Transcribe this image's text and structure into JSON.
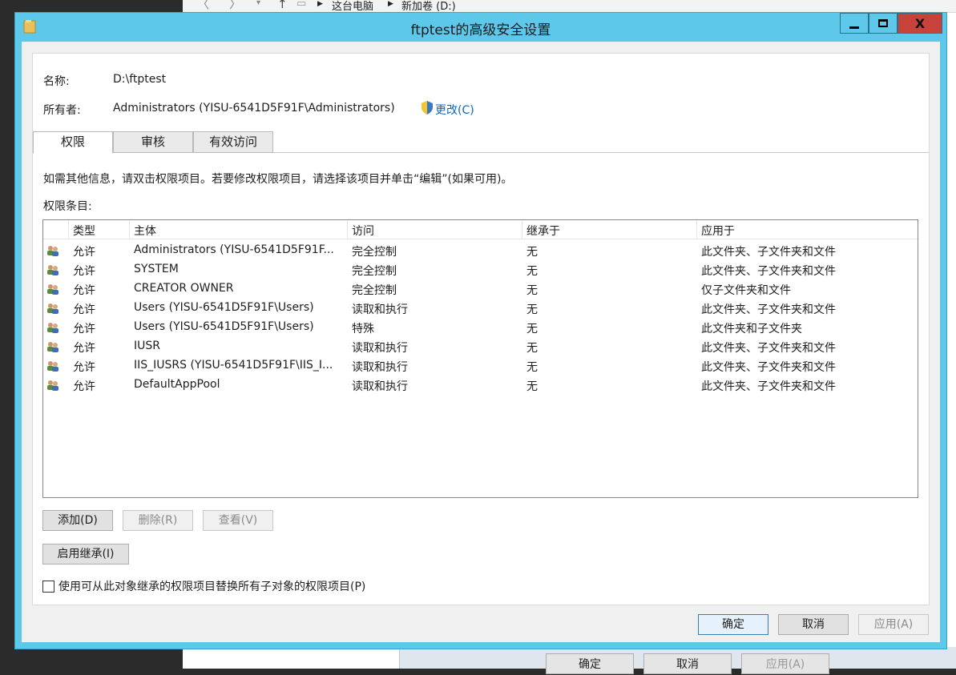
{
  "background": {
    "breadcrumb": [
      "这台电脑",
      "新加卷 (D:)"
    ],
    "buttons": [
      "确定",
      "取消",
      "应用(A)"
    ]
  },
  "window": {
    "title": "ftptest的高级安全设置",
    "controls": {
      "minimize": "minimize-icon",
      "maximize": "maximize-icon",
      "close": "X"
    }
  },
  "info": {
    "name_label": "名称:",
    "name_value": "D:\\ftptest",
    "owner_label": "所有者:",
    "owner_value": "Administrators (YISU-6541D5F91F\\Administrators)",
    "change_link": "更改(C)"
  },
  "tabs": [
    {
      "label": "权限",
      "active": true
    },
    {
      "label": "审核",
      "active": false
    },
    {
      "label": "有效访问",
      "active": false
    }
  ],
  "permissions": {
    "hint": "如需其他信息，请双击权限项目。若要修改权限项目，请选择该项目并单击“编辑”(如果可用)。",
    "entries_label": "权限条目:",
    "columns": [
      "类型",
      "主体",
      "访问",
      "继承于",
      "应用于"
    ],
    "rows": [
      {
        "type": "允许",
        "principal": "Administrators (YISU-6541D5F91F...",
        "access": "完全控制",
        "inherited": "无",
        "applies": "此文件夹、子文件夹和文件"
      },
      {
        "type": "允许",
        "principal": "SYSTEM",
        "access": "完全控制",
        "inherited": "无",
        "applies": "此文件夹、子文件夹和文件"
      },
      {
        "type": "允许",
        "principal": "CREATOR OWNER",
        "access": "完全控制",
        "inherited": "无",
        "applies": "仅子文件夹和文件"
      },
      {
        "type": "允许",
        "principal": "Users (YISU-6541D5F91F\\Users)",
        "access": "读取和执行",
        "inherited": "无",
        "applies": "此文件夹、子文件夹和文件"
      },
      {
        "type": "允许",
        "principal": "Users (YISU-6541D5F91F\\Users)",
        "access": "特殊",
        "inherited": "无",
        "applies": "此文件夹和子文件夹"
      },
      {
        "type": "允许",
        "principal": "IUSR",
        "access": "读取和执行",
        "inherited": "无",
        "applies": "此文件夹、子文件夹和文件"
      },
      {
        "type": "允许",
        "principal": "IIS_IUSRS (YISU-6541D5F91F\\IIS_I...",
        "access": "读取和执行",
        "inherited": "无",
        "applies": "此文件夹、子文件夹和文件"
      },
      {
        "type": "允许",
        "principal": "DefaultAppPool",
        "access": "读取和执行",
        "inherited": "无",
        "applies": "此文件夹、子文件夹和文件"
      }
    ]
  },
  "actions": {
    "add": "添加(D)",
    "remove": "删除(R)",
    "view": "查看(V)",
    "enable_inheritance": "启用继承(I)",
    "replace_checkbox": "使用可从此对象继承的权限项目替换所有子对象的权限项目(P)"
  },
  "footer": {
    "ok": "确定",
    "cancel": "取消",
    "apply": "应用(A)"
  },
  "colors": {
    "titlebar": "#5ec8ea",
    "close": "#c7423a",
    "link": "#0b66c3"
  }
}
